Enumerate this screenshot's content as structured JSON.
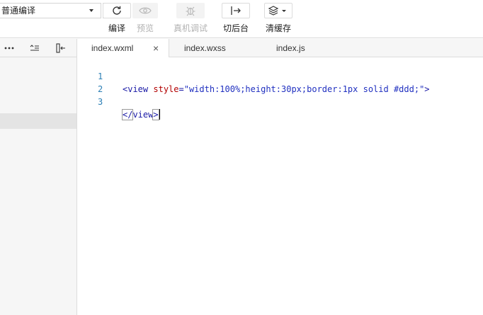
{
  "toolbar": {
    "compile_mode": "普通编译",
    "buttons": [
      {
        "id": "compile",
        "label": "编译",
        "icon": "refresh-icon",
        "disabled": false
      },
      {
        "id": "preview",
        "label": "预览",
        "icon": "eye-icon",
        "disabled": true
      },
      {
        "id": "remote_debug",
        "label": "真机调试",
        "icon": "bug-icon",
        "disabled": true
      },
      {
        "id": "background",
        "label": "切后台",
        "icon": "switch-background-icon",
        "disabled": false
      },
      {
        "id": "clear_cache",
        "label": "清缓存",
        "icon": "layers-icon",
        "disabled": false
      }
    ]
  },
  "left_panel": {
    "icons": [
      "more-icon",
      "collapse-tree-icon",
      "panel-toggle-icon"
    ]
  },
  "editor": {
    "tabs": [
      {
        "label": "index.wxml",
        "active": true,
        "closable": true,
        "close_glyph": "×"
      },
      {
        "label": "index.wxss",
        "active": false
      },
      {
        "label": "index.js",
        "active": false
      }
    ],
    "lines": [
      {
        "number": "1",
        "open": "<",
        "tag": "view",
        "attr": " style",
        "eq": "=",
        "value": "\"width:100%;height:30px;border:1px solid #ddd;\"",
        "close": ">"
      },
      {
        "number": "2"
      },
      {
        "number": "3",
        "open": "</",
        "tag": "view",
        "close": ">"
      }
    ]
  }
}
